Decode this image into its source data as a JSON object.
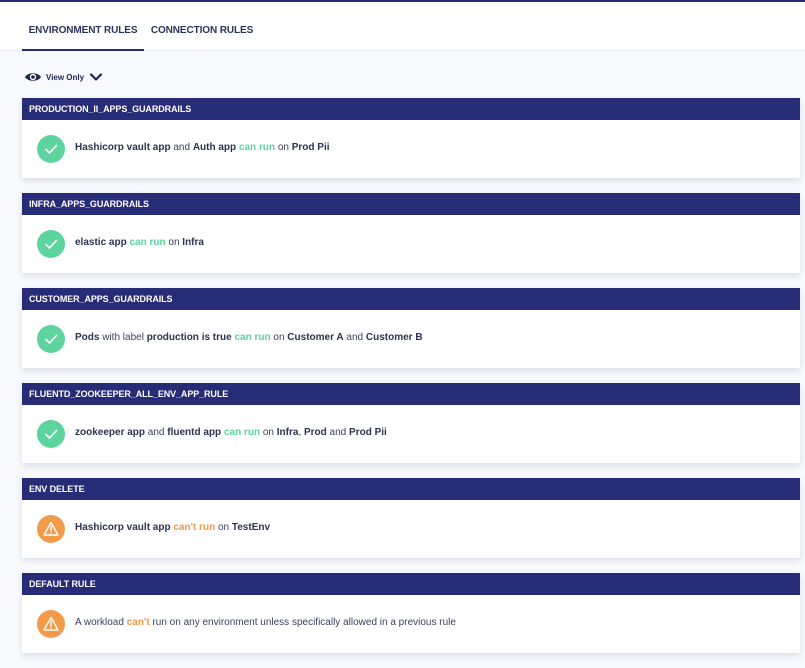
{
  "tabs": [
    {
      "label": "ENVIRONMENT RULES",
      "active": true
    },
    {
      "label": "CONNECTION RULES",
      "active": false
    }
  ],
  "view_mode": {
    "label": "View Only",
    "icon": "eye-icon"
  },
  "colors": {
    "header": "#262c75",
    "allow": "#5dd39e",
    "deny": "#f2994a"
  },
  "rules": [
    {
      "title": "PRODUCTION_II_APPS_GUARDRAILS",
      "status": "ok",
      "parts": [
        {
          "text": "Hashicorp vault app",
          "style": "b"
        },
        {
          "text": " and ",
          "style": "n"
        },
        {
          "text": "Auth app",
          "style": "b"
        },
        {
          "text": " ",
          "style": "n"
        },
        {
          "text": "can run",
          "style": "allow"
        },
        {
          "text": " on ",
          "style": "n"
        },
        {
          "text": "Prod Pii",
          "style": "b"
        }
      ]
    },
    {
      "title": "INFRA_APPS_GUARDRAILS",
      "status": "ok",
      "parts": [
        {
          "text": "elastic app",
          "style": "b"
        },
        {
          "text": " ",
          "style": "n"
        },
        {
          "text": "can run",
          "style": "allow"
        },
        {
          "text": " on ",
          "style": "n"
        },
        {
          "text": "Infra",
          "style": "b"
        }
      ]
    },
    {
      "title": "CUSTOMER_APPS_GUARDRAILS",
      "status": "ok",
      "parts": [
        {
          "text": "Pods",
          "style": "b"
        },
        {
          "text": " with label ",
          "style": "n"
        },
        {
          "text": "production is true",
          "style": "b"
        },
        {
          "text": " ",
          "style": "n"
        },
        {
          "text": "can run",
          "style": "allow"
        },
        {
          "text": " on ",
          "style": "n"
        },
        {
          "text": "Customer A",
          "style": "b"
        },
        {
          "text": " and ",
          "style": "n"
        },
        {
          "text": "Customer B",
          "style": "b"
        }
      ]
    },
    {
      "title": "FLUENTD_ZOOKEEPER_ALL_ENV_APP_RULE",
      "status": "ok",
      "parts": [
        {
          "text": "zookeeper app",
          "style": "b"
        },
        {
          "text": " and ",
          "style": "n"
        },
        {
          "text": "fluentd app",
          "style": "b"
        },
        {
          "text": " ",
          "style": "n"
        },
        {
          "text": "can run",
          "style": "allow"
        },
        {
          "text": " on ",
          "style": "n"
        },
        {
          "text": "Infra",
          "style": "b"
        },
        {
          "text": ", ",
          "style": "n"
        },
        {
          "text": "Prod",
          "style": "b"
        },
        {
          "text": " and ",
          "style": "n"
        },
        {
          "text": "Prod Pii",
          "style": "b"
        }
      ]
    },
    {
      "title": "ENV DELETE",
      "status": "warn",
      "parts": [
        {
          "text": "Hashicorp vault app",
          "style": "b"
        },
        {
          "text": " ",
          "style": "n"
        },
        {
          "text": "can't run",
          "style": "deny"
        },
        {
          "text": " on ",
          "style": "n"
        },
        {
          "text": "TestEnv",
          "style": "b"
        }
      ]
    },
    {
      "title": "DEFAULT RULE",
      "status": "warn",
      "parts": [
        {
          "text": "A workload ",
          "style": "n"
        },
        {
          "text": "can't",
          "style": "deny"
        },
        {
          "text": " run on any environment unless specifically allowed in a previous rule",
          "style": "n"
        }
      ]
    }
  ]
}
